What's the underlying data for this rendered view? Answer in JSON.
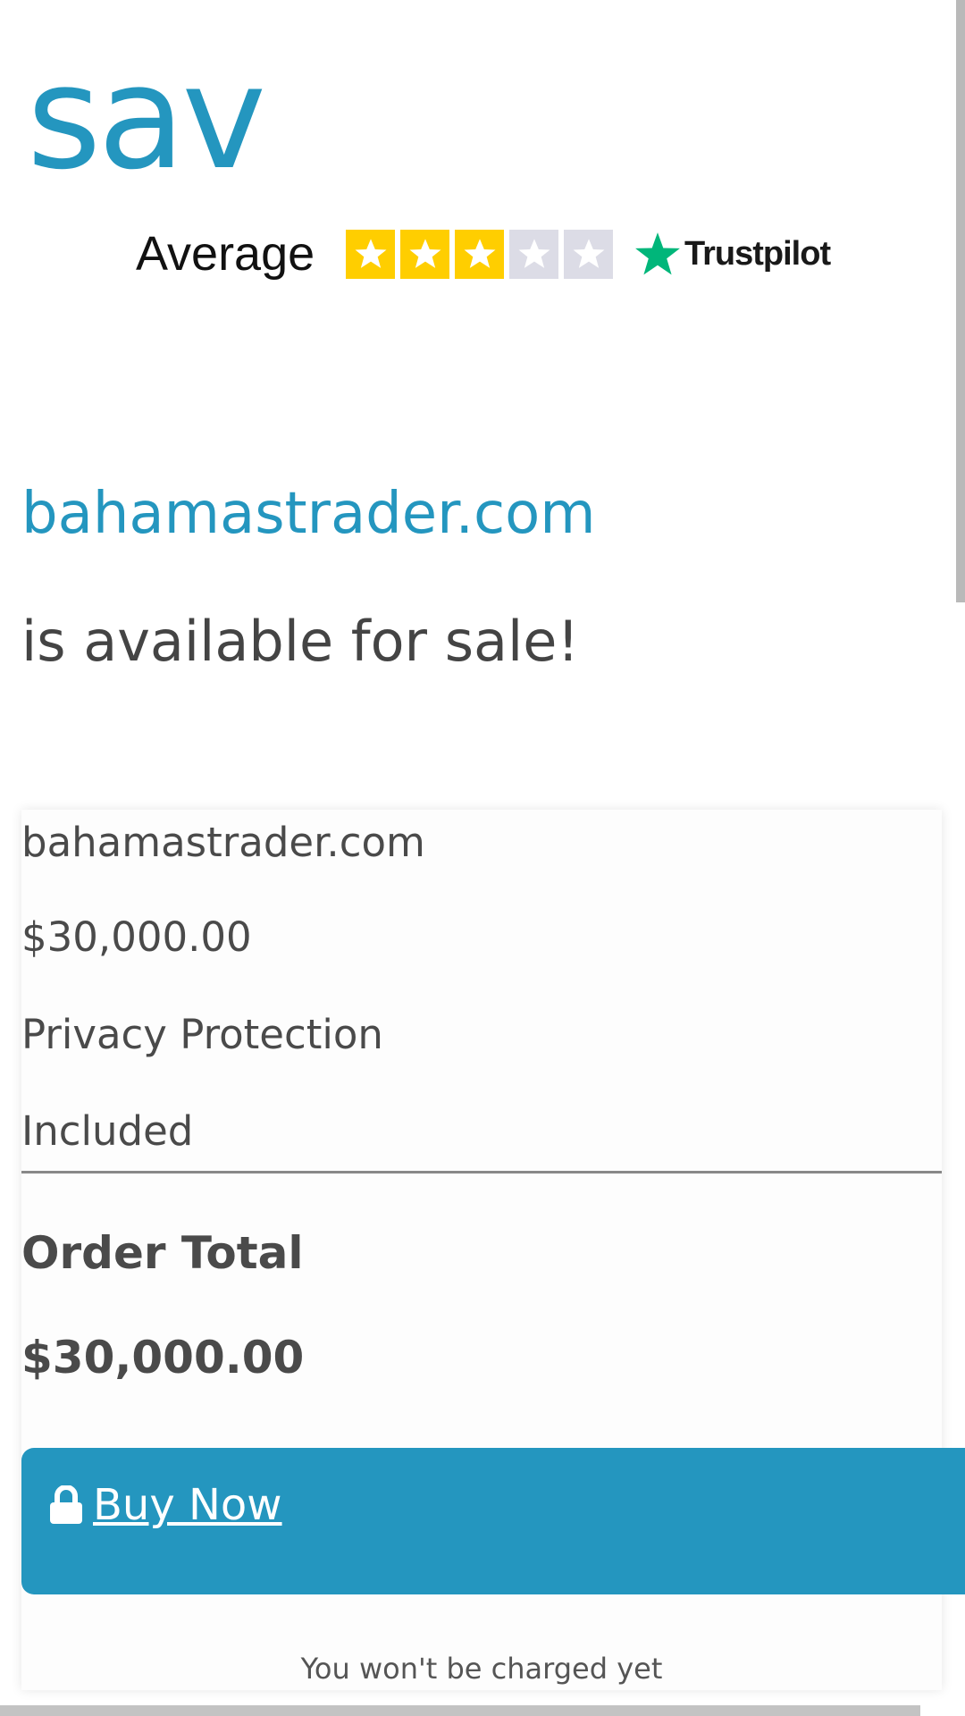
{
  "logo": {
    "text": "sav"
  },
  "rating": {
    "label": "Average",
    "stars_filled": 3,
    "stars_total": 5,
    "provider": "Trustpilot",
    "colors": {
      "filled": "#ffce00",
      "empty": "#dcdce6",
      "brand": "#00b67a"
    }
  },
  "headline": {
    "domain": "bahamastrader.com",
    "subtitle": "is available for sale!"
  },
  "order": {
    "domain": "bahamastrader.com",
    "price": "$30,000.00",
    "privacy_label": "Privacy Protection",
    "privacy_value": "Included",
    "total_label": "Order Total",
    "total_value": "$30,000.00"
  },
  "buy": {
    "label": " Buy Now",
    "icon": "lock-icon"
  },
  "footer": {
    "note": "You won't be charged yet"
  },
  "colors": {
    "accent": "#2496bf",
    "text": "#4a4a4a"
  }
}
